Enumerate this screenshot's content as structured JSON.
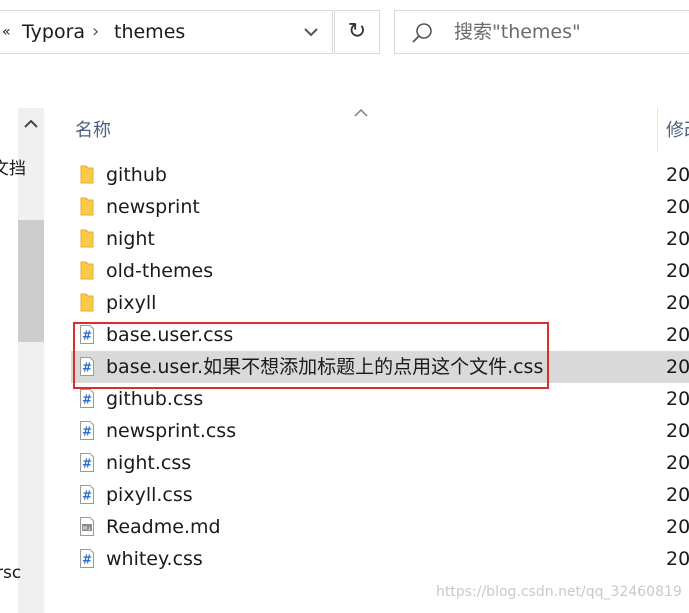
{
  "address_bar": {
    "overflow_glyph": "«",
    "path": [
      "Typora",
      "themes"
    ],
    "separator": "›"
  },
  "search": {
    "placeholder": "搜索\"themes\""
  },
  "nav_pane": {
    "partial_labels": [
      "文挡",
      "rsc"
    ]
  },
  "columns": {
    "name": "名称",
    "modified": "修改"
  },
  "files": [
    {
      "name": "github",
      "type": "folder",
      "modified": "20"
    },
    {
      "name": "newsprint",
      "type": "folder",
      "modified": "20"
    },
    {
      "name": "night",
      "type": "folder",
      "modified": "20"
    },
    {
      "name": "old-themes",
      "type": "folder",
      "modified": "20"
    },
    {
      "name": "pixyll",
      "type": "folder",
      "modified": "20"
    },
    {
      "name": "base.user.css",
      "type": "css",
      "modified": "20"
    },
    {
      "name": "base.user.如果不想添加标题上的点用这个文件.css",
      "type": "css",
      "modified": "20",
      "selected": true
    },
    {
      "name": "github.css",
      "type": "css",
      "modified": "20"
    },
    {
      "name": "newsprint.css",
      "type": "css",
      "modified": "20"
    },
    {
      "name": "night.css",
      "type": "css",
      "modified": "20"
    },
    {
      "name": "pixyll.css",
      "type": "css",
      "modified": "20"
    },
    {
      "name": "Readme.md",
      "type": "md",
      "modified": "20"
    },
    {
      "name": "whitey.css",
      "type": "css",
      "modified": "20"
    }
  ],
  "watermark": "https://blog.csdn.net/qq_32460819",
  "colors": {
    "folder": "#f8c94a",
    "css_hash": "#2b73c7",
    "selection": "#d9d9d9",
    "highlight_border": "#e02b2b",
    "header_text": "#4d6182"
  }
}
